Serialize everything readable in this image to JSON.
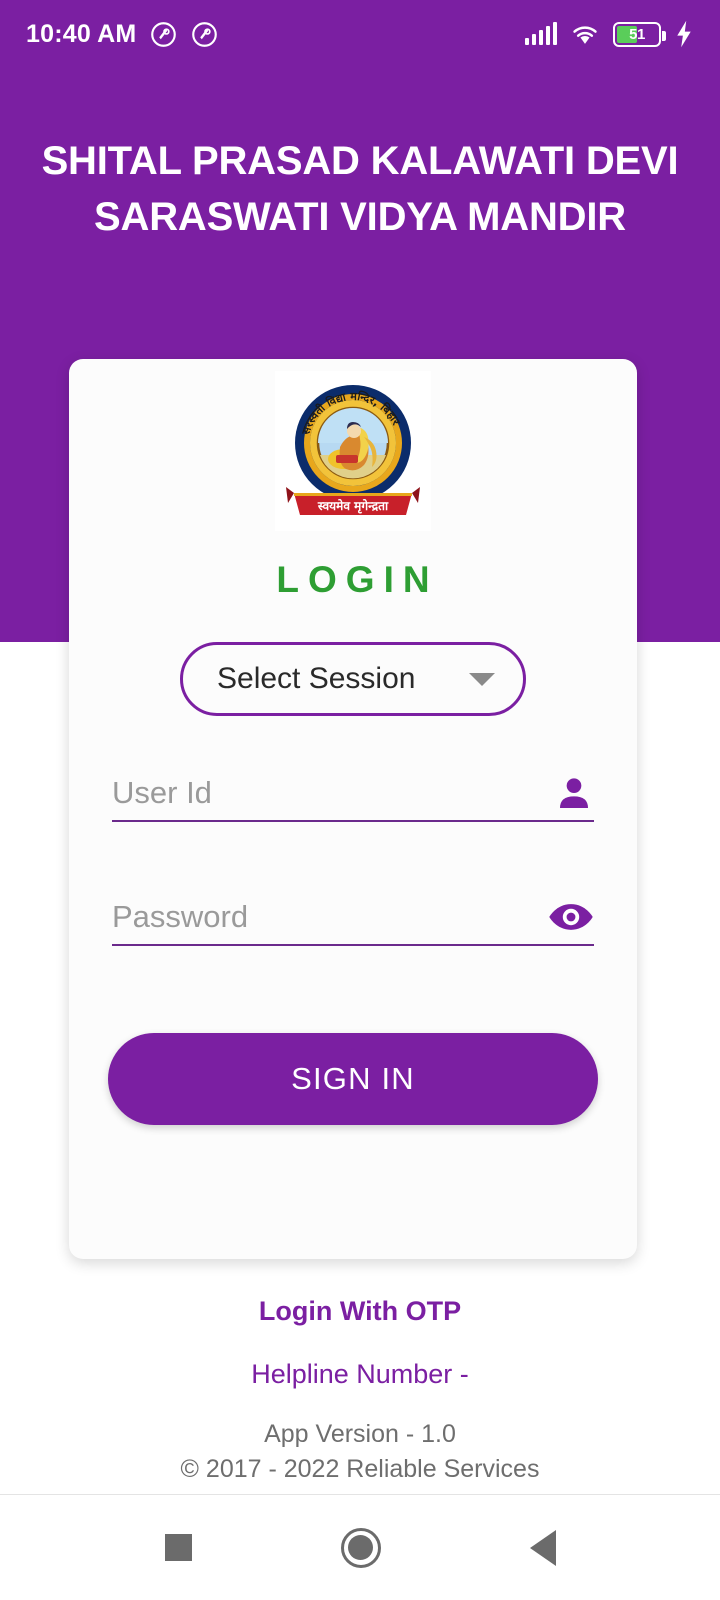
{
  "status_bar": {
    "clock": "10:40 AM",
    "notification_icons": [
      "app-notification-icon",
      "app-notification-icon"
    ],
    "signal_icon": "cellular-signal-icon",
    "wifi_icon": "wifi-icon",
    "battery_level": "51",
    "battery_percent_value": 51,
    "charging_icon": "charging-bolt-icon"
  },
  "header": {
    "school_title": "SHITAL PRASAD KALAWATI DEVI SARASWATI VIDYA MANDIR",
    "background_color": "#7B1FA2"
  },
  "card": {
    "logo": {
      "name": "school-emblem-logo",
      "ring_text_top": "सरस्वती विद्या मन्दिर, बिहार",
      "banner_text": "स्वयमेव मृगेन्द्रता"
    },
    "login_heading": "LOGIN",
    "login_heading_color": "#2E9E33",
    "session": {
      "label": "Select Session",
      "dropdown_icon": "chevron-down-icon",
      "border_color": "#7B1FA2"
    },
    "user_id": {
      "placeholder": "User Id",
      "value": "",
      "icon": "person-icon"
    },
    "password": {
      "placeholder": "Password",
      "value": "",
      "icon": "eye-visibility-icon"
    },
    "signin_label": "SIGN IN",
    "signin_color": "#7B1FA2"
  },
  "footer": {
    "otp_link": "Login With OTP",
    "helpline": "Helpline Number -",
    "app_version": "App Version - 1.0",
    "copyright": "© 2017 - 2022 Reliable Services",
    "link_color": "#7B1FA2"
  },
  "nav_bar": {
    "recents_icon": "square-recents-icon",
    "home_icon": "circle-home-icon",
    "back_icon": "triangle-back-icon"
  }
}
